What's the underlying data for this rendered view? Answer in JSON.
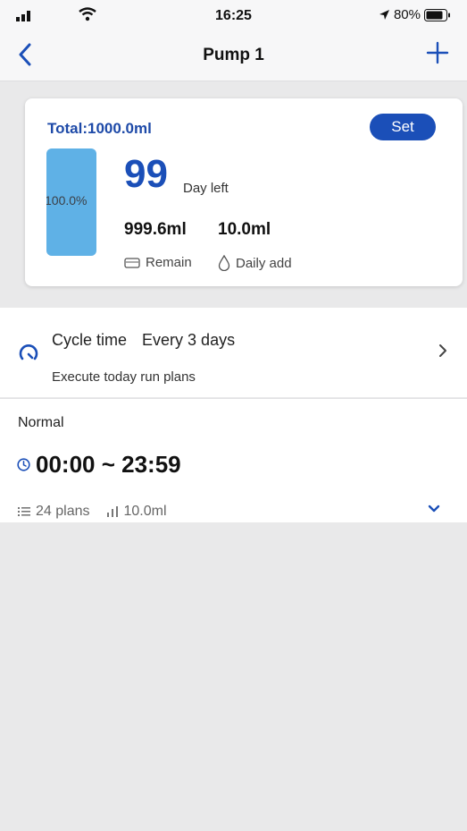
{
  "status_bar": {
    "time": "16:25",
    "battery": "80%"
  },
  "nav": {
    "title": "Pump 1",
    "back_icon": "chevron-left-icon",
    "add_icon": "plus-icon"
  },
  "summary": {
    "total": "Total:1000.0ml",
    "set_label": "Set",
    "tank_percent_label": "100.0%",
    "tank_level": 1.0,
    "days_left": "99",
    "days_left_label": "Day left",
    "remain_value": "999.6ml",
    "remain_label": "Remain",
    "daily_add_value": "10.0ml",
    "daily_add_label": "Daily add"
  },
  "cycle": {
    "label": "Cycle time",
    "value": "Every 3 days",
    "subtitle": "Execute today run plans"
  },
  "plan": {
    "mode": "Normal",
    "time_range": "00:00 ~ 23:59",
    "plans_count": "24 plans",
    "amount": "10.0ml"
  },
  "colors": {
    "accent": "#1b4fb8",
    "tank_fill": "#5fb1e6",
    "background": "#e9e9ea"
  }
}
